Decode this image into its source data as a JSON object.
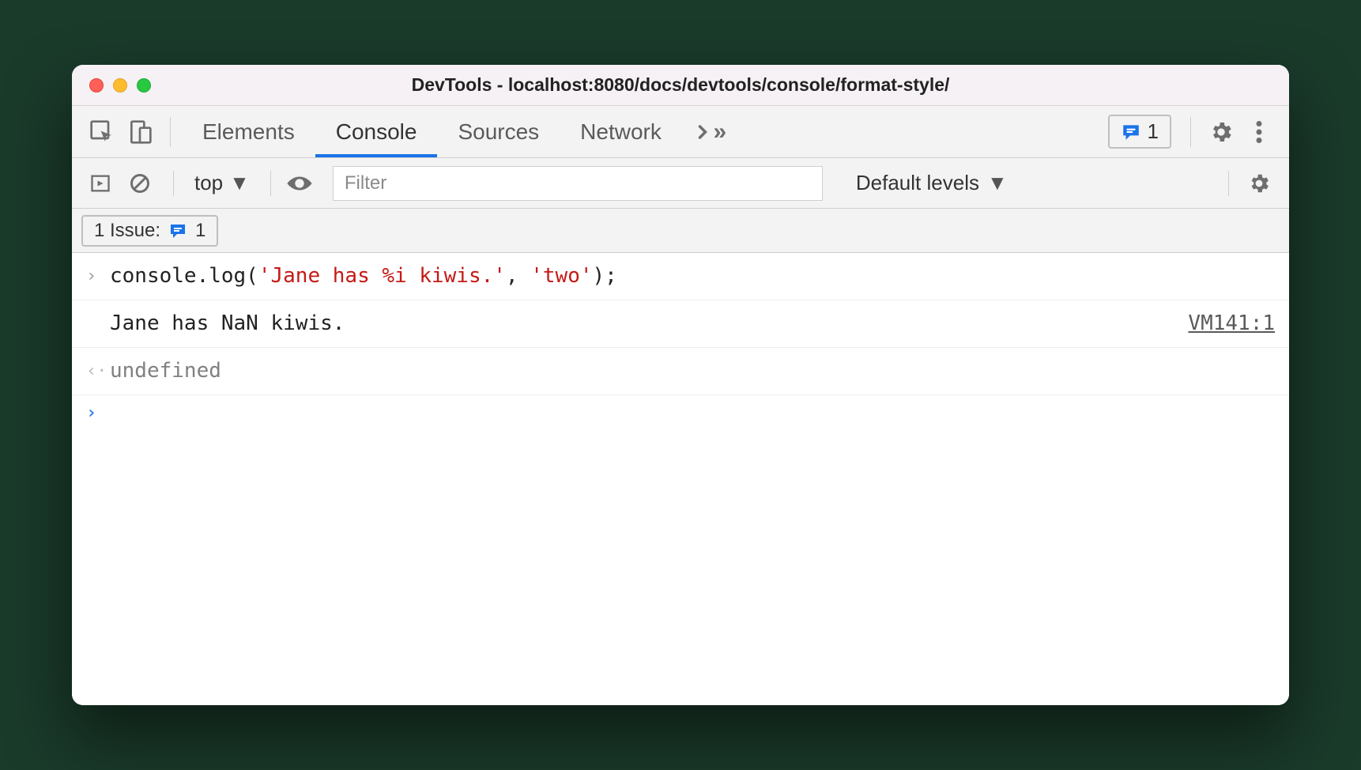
{
  "window": {
    "title": "DevTools - localhost:8080/docs/devtools/console/format-style/"
  },
  "tabs": {
    "elements": "Elements",
    "console": "Console",
    "sources": "Sources",
    "network": "Network"
  },
  "issues_badge": {
    "count": "1"
  },
  "toolbar": {
    "context": "top",
    "filter_placeholder": "Filter",
    "levels": "Default levels"
  },
  "issue_chip": {
    "label": "1 Issue:",
    "count": "1"
  },
  "console": {
    "rows": [
      {
        "type": "input",
        "code_pre": "console.log(",
        "code_str1": "'Jane has %i kiwis.'",
        "code_mid": ", ",
        "code_str2": "'two'",
        "code_post": ");"
      },
      {
        "type": "output",
        "text": "Jane has NaN kiwis.",
        "source": "VM141:1"
      },
      {
        "type": "return",
        "text": "undefined"
      }
    ]
  }
}
